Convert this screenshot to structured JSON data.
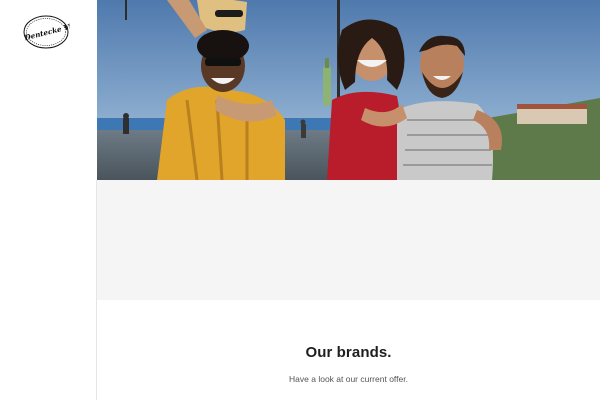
{
  "logo": {
    "text": "La Dentecke Vita"
  },
  "hero": {
    "image_alt": "Group of friends laughing outdoors on a sunny promenade"
  },
  "brands": {
    "title": "Our brands.",
    "subtitle": "Have a look at our current offer."
  },
  "colors": {
    "sky_top": "#5b84b6",
    "sky_bottom": "#9bb9d6",
    "band_gray": "#f5f5f5",
    "title": "#1e1e1e",
    "subtitle": "#555555"
  }
}
